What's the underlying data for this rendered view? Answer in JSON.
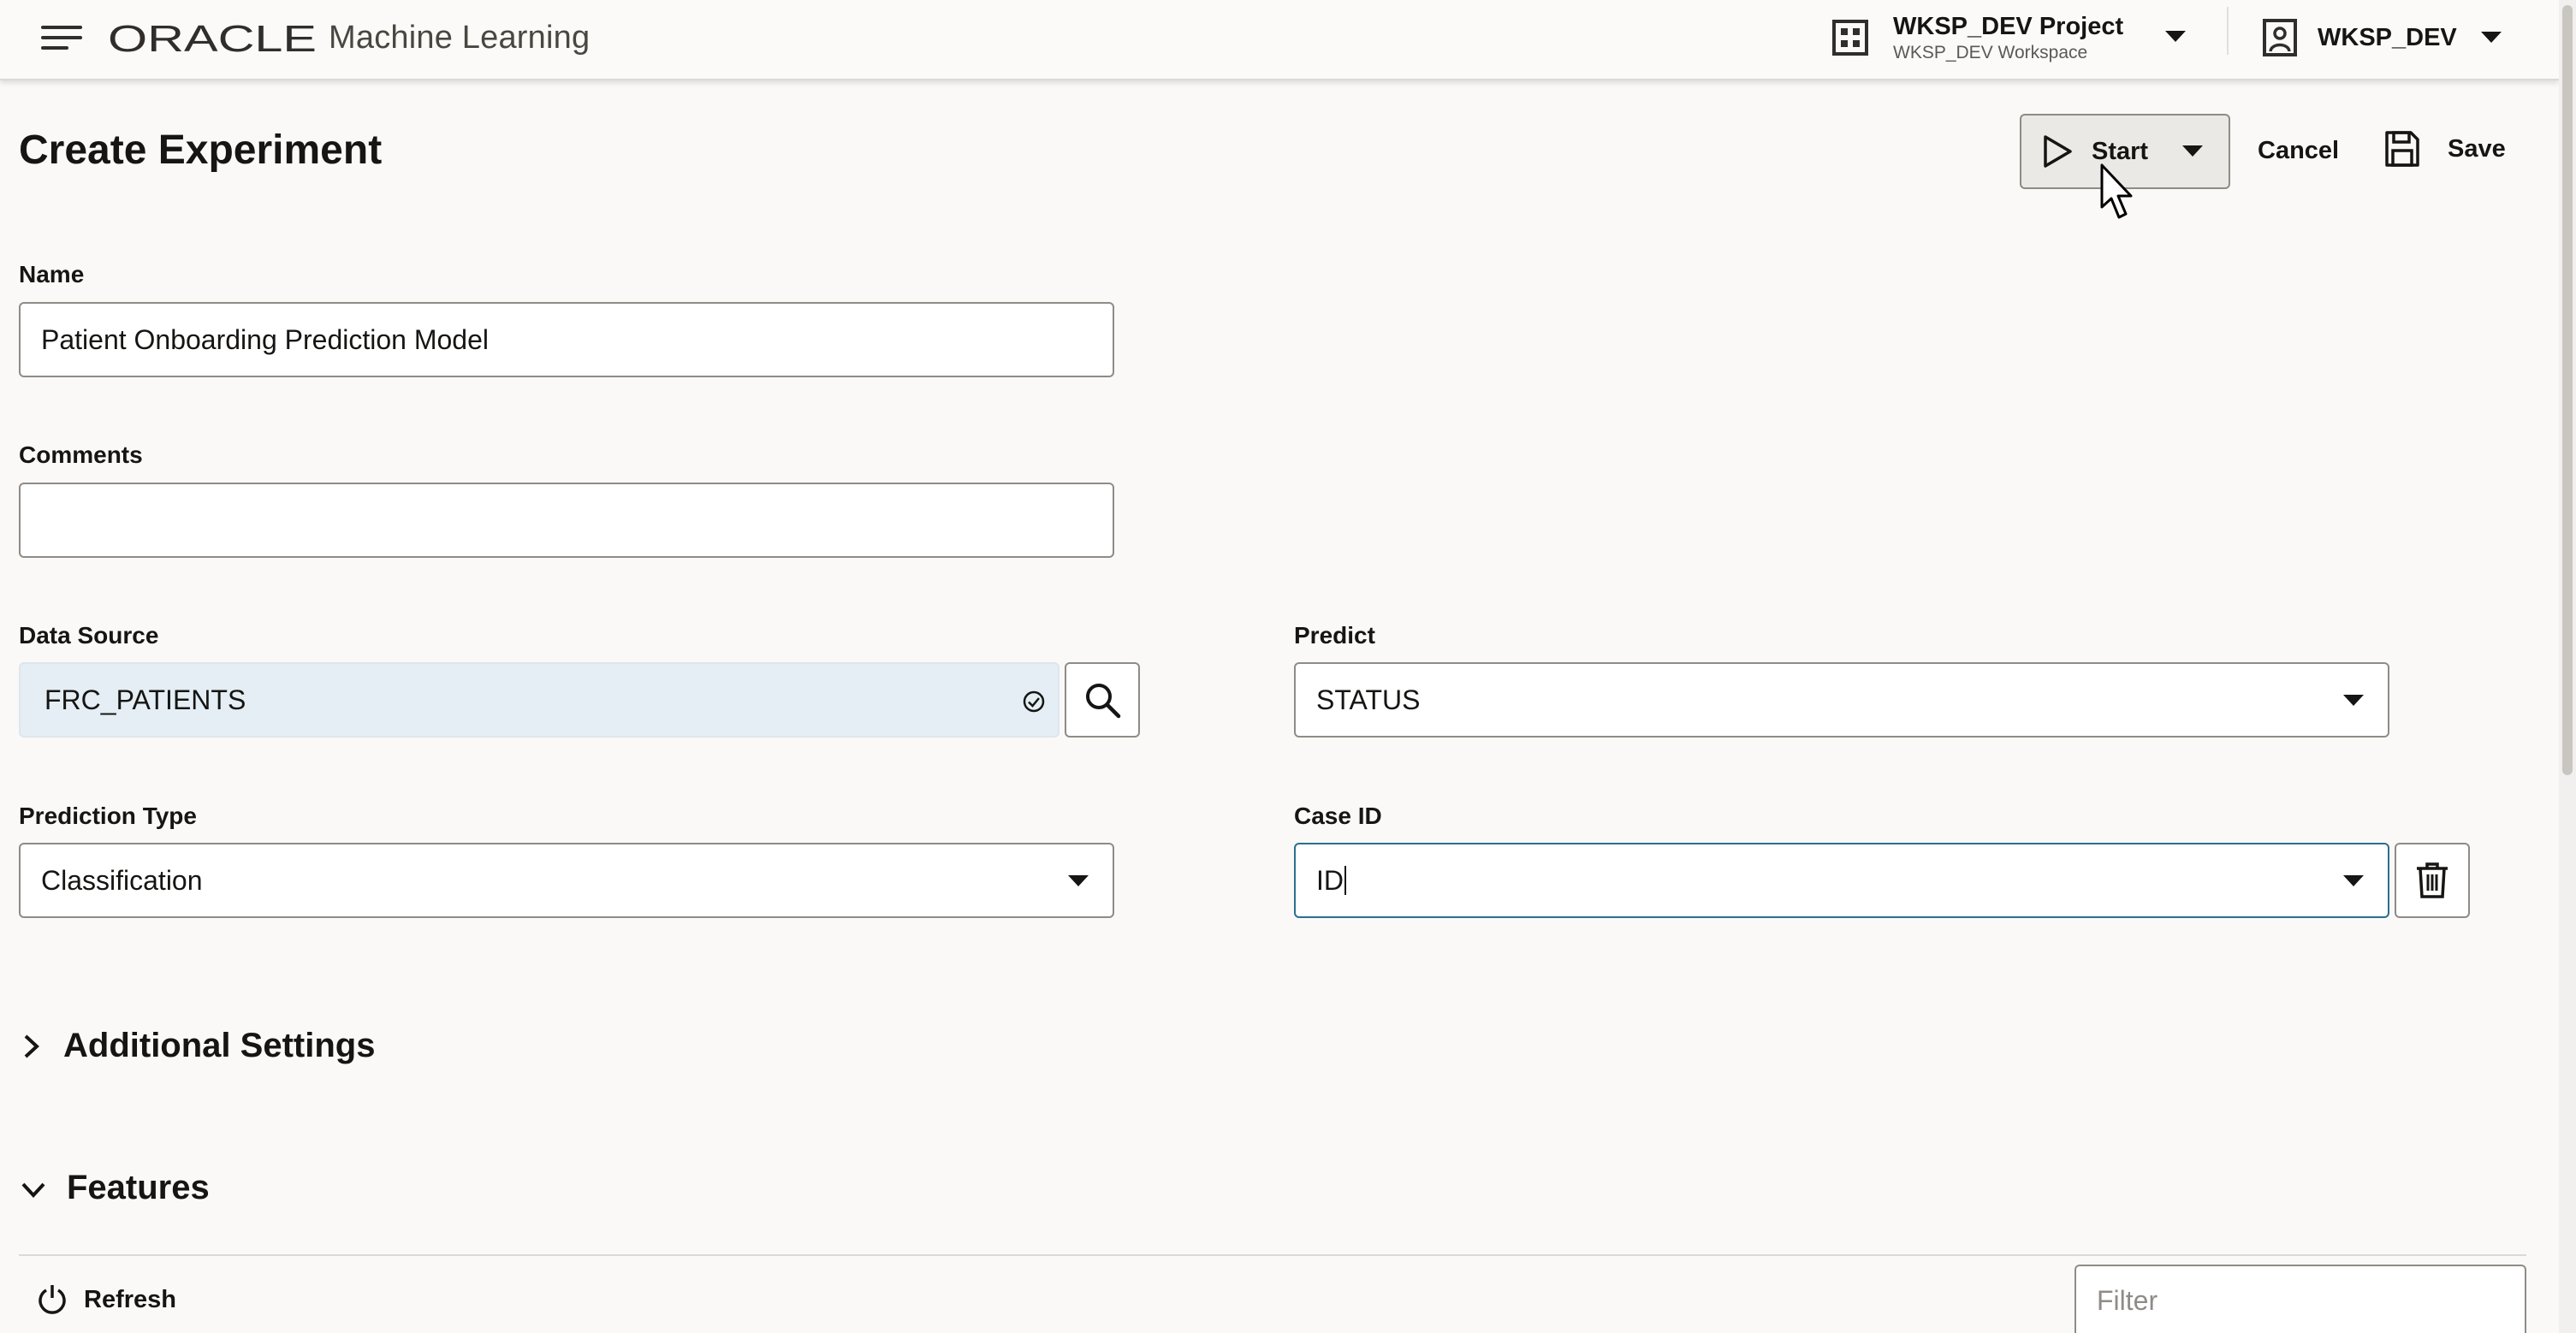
{
  "header": {
    "brand_name": "ORACLE",
    "app_name": "Machine Learning",
    "project_title": "WKSP_DEV Project",
    "project_subtitle": "WKSP_DEV Workspace",
    "user_name": "WKSP_DEV"
  },
  "page": {
    "title": "Create Experiment"
  },
  "toolbar": {
    "start_label": "Start",
    "cancel_label": "Cancel",
    "save_label": "Save"
  },
  "form": {
    "name_label": "Name",
    "name_value": "Patient Onboarding Prediction Model",
    "comments_label": "Comments",
    "comments_value": "",
    "data_source_label": "Data Source",
    "data_source_value": "FRC_PATIENTS",
    "predict_label": "Predict",
    "predict_value": "STATUS",
    "prediction_type_label": "Prediction Type",
    "prediction_type_value": "Classification",
    "case_id_label": "Case ID",
    "case_id_value": "ID"
  },
  "sections": {
    "additional_settings": "Additional Settings",
    "features": "Features"
  },
  "features_toolbar": {
    "refresh_label": "Refresh",
    "filter_placeholder": "Filter"
  },
  "icons": {
    "menu": "hamburger-menu-icon",
    "project": "grid-icon",
    "user": "user-badge-icon",
    "start": "play-icon",
    "save": "floppy-disk-icon",
    "search": "search-icon",
    "delete": "trash-icon",
    "refresh": "refresh-icon",
    "validated": "check-circle-icon"
  },
  "colors": {
    "background": "#faf9f7",
    "text": "#161513",
    "border": "#8f8b86",
    "focus": "#2a6f8e",
    "readonly_field": "#e4eef4"
  }
}
